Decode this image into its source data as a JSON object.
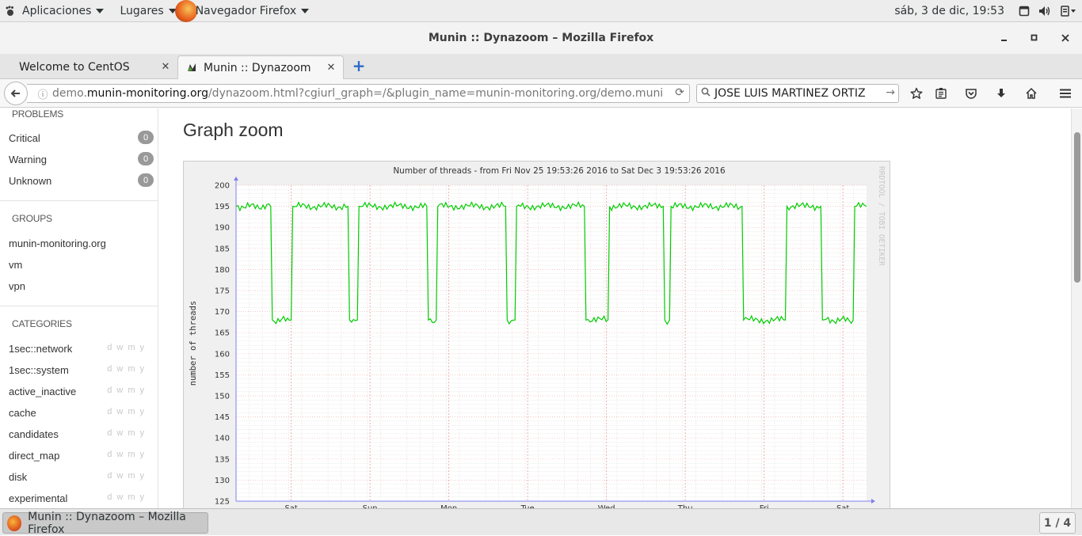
{
  "topbar": {
    "apps_label": "Aplicaciones",
    "places_label": "Lugares",
    "browser_label": "Navegador Firefox",
    "clock": "sáb,  3 de dic, 19:53"
  },
  "window": {
    "title": "Munin :: Dynazoom – Mozilla Firefox"
  },
  "tabs": [
    {
      "label": "Welcome to CentOS"
    },
    {
      "label": "Munin :: Dynazoom"
    }
  ],
  "navbar": {
    "url_prefix": "demo.",
    "url_host": "munin-monitoring.org",
    "url_path": "/dynazoom.html?cgiurl_graph=/&plugin_name=munin-monitoring.org/demo.munin-mon",
    "search_value": "JOSE LUIS MARTINEZ ORTIZ"
  },
  "sidebar": {
    "problems_title": "PROBLEMS",
    "problems": [
      {
        "label": "Critical",
        "count": "0"
      },
      {
        "label": "Warning",
        "count": "0"
      },
      {
        "label": "Unknown",
        "count": "0"
      }
    ],
    "groups_title": "GROUPS",
    "groups": [
      {
        "label": "munin-monitoring.org"
      },
      {
        "label": "vm"
      },
      {
        "label": "vpn"
      }
    ],
    "categories_title": "CATEGORIES",
    "period_links": "dwmy",
    "categories": [
      {
        "label": "1sec::network"
      },
      {
        "label": "1sec::system"
      },
      {
        "label": "active_inactive"
      },
      {
        "label": "cache"
      },
      {
        "label": "candidates"
      },
      {
        "label": "direct_map"
      },
      {
        "label": "disk"
      },
      {
        "label": "experimental"
      }
    ]
  },
  "main": {
    "heading": "Graph zoom"
  },
  "chart_data": {
    "type": "line",
    "title": "Number of threads - from Fri Nov 25 19:53:26 2016 to Sat Dec  3 19:53:26 2016",
    "ylabel": "number of threads",
    "xlabel": "",
    "watermark": "RRDTOOL / TOBI OETIKER",
    "ylim": [
      125,
      200
    ],
    "yticks": [
      200,
      195,
      190,
      185,
      180,
      175,
      170,
      165,
      160,
      155,
      150,
      145,
      140,
      135,
      130,
      125
    ],
    "xticks": [
      "Sat",
      "Sun",
      "Mon",
      "Tue",
      "Wed",
      "Thu",
      "Fri",
      "Sat"
    ],
    "xlim": [
      0,
      8
    ],
    "line_color": "#00cc00",
    "grid": true,
    "series": [
      {
        "name": "",
        "x": [
          0,
          0.44,
          0.46,
          0.7,
          0.72,
          1.42,
          1.44,
          1.54,
          1.56,
          2.42,
          2.44,
          2.54,
          2.56,
          3.42,
          3.44,
          3.54,
          3.56,
          4.42,
          4.44,
          4.72,
          4.74,
          5.42,
          5.44,
          5.5,
          5.52,
          6.42,
          6.44,
          6.97,
          6.99,
          7.42,
          7.44,
          7.83,
          7.85,
          8.0
        ],
        "y": [
          195,
          195,
          168,
          168,
          195,
          195,
          168,
          168,
          195,
          195,
          168,
          168,
          195,
          195,
          168,
          168,
          195,
          195,
          168,
          168,
          195,
          195,
          168,
          168,
          195,
          195,
          168,
          168,
          195,
          195,
          168,
          168,
          195,
          195
        ]
      }
    ]
  },
  "taskbar": {
    "task_label": "Munin :: Dynazoom – Mozilla Firefox",
    "pager": "1 / 4"
  }
}
